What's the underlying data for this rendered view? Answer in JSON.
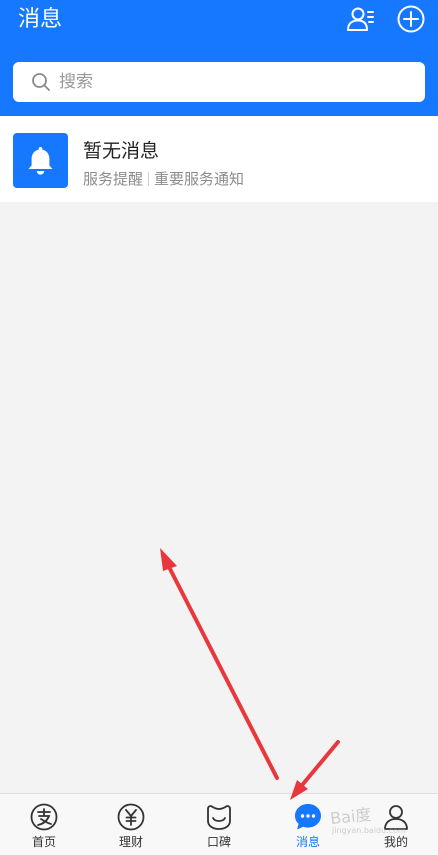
{
  "header": {
    "title": "消息",
    "accent_color": "#1677ff",
    "icons": [
      "contacts-icon",
      "add-icon"
    ]
  },
  "search": {
    "placeholder": "搜索",
    "icon": "search-icon"
  },
  "messages": [
    {
      "title": "暂无消息",
      "tag": "服务提醒",
      "subtitle": "重要服务通知",
      "icon": "bell-icon"
    }
  ],
  "tabbar": {
    "tabs": [
      {
        "label": "首页",
        "icon": "alipay-home-icon",
        "active": false
      },
      {
        "label": "理财",
        "icon": "yuan-icon",
        "active": false
      },
      {
        "label": "口碑",
        "icon": "koubei-icon",
        "active": false
      },
      {
        "label": "消息",
        "icon": "chat-bubble-icon",
        "active": true
      },
      {
        "label": "我的",
        "icon": "person-icon",
        "active": false
      }
    ],
    "active_color": "#1677ff"
  },
  "watermark": {
    "text": "Bai度",
    "sub": "jingyan.baidu.com"
  },
  "annotation_color": "#e8373d"
}
